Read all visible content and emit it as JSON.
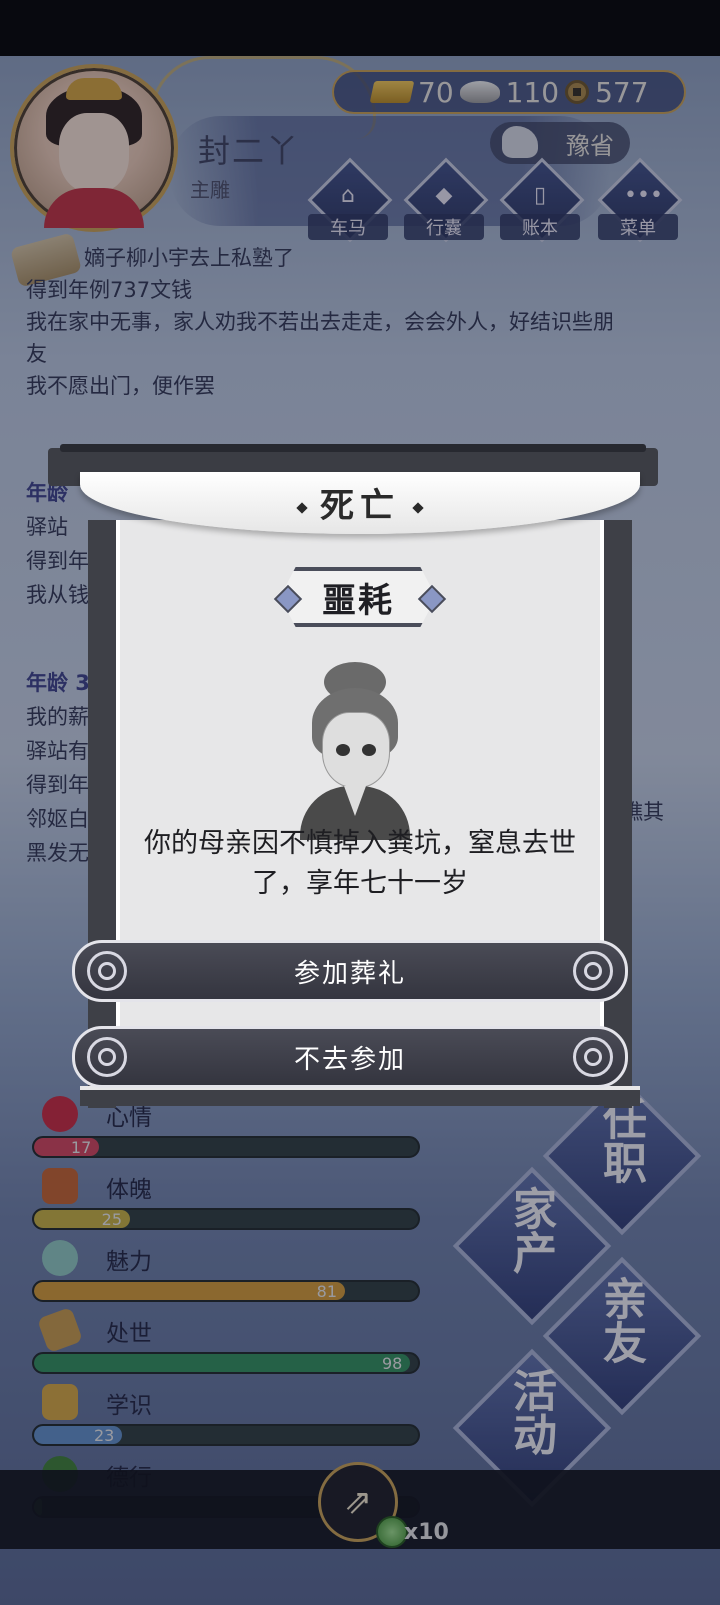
{
  "header": {
    "character_name": "封二丫",
    "character_rank": "主雕",
    "currency": {
      "gold": "70",
      "silver": "110",
      "copper": "577"
    },
    "region": "豫省"
  },
  "menu": [
    {
      "label": "车马",
      "icon": "carriage-icon"
    },
    {
      "label": "行囊",
      "icon": "bag-icon"
    },
    {
      "label": "账本",
      "icon": "ledger-icon"
    },
    {
      "label": "菜单",
      "icon": "more-icon"
    }
  ],
  "log": {
    "lines": [
      "嫡子柳小宇去上私塾了",
      "得到年例737文钱",
      "我在家中无事，家人劝我不若出去走走，会会外人，好结识些朋",
      "友",
      "我不愿出门，便作罢"
    ],
    "block2": {
      "head": "年龄",
      "lines": [
        "驿站",
        "得到年",
        "我从钱"
      ]
    },
    "block3": {
      "head": "年龄 3",
      "lines": [
        "我的薪",
        "驿站有",
        "得到年",
        "邻妪白",
        "黑发无"
      ],
      "tail": "瞧其"
    }
  },
  "stats": [
    {
      "name": "心情",
      "value": 17,
      "color": "#d2435b",
      "icon": "flower-icon"
    },
    {
      "name": "体魄",
      "value": 25,
      "color": "#c7b13f",
      "icon": "body-icon"
    },
    {
      "name": "魅力",
      "value": 81,
      "color": "#d39a34",
      "icon": "charm-icon"
    },
    {
      "name": "处世",
      "value": 98,
      "color": "#2f8f5b",
      "icon": "worldly-icon"
    },
    {
      "name": "学识",
      "value": 23,
      "color": "#5f8fc9",
      "icon": "book-icon"
    },
    {
      "name": "德行",
      "value": 0,
      "color": "#4a8f3f",
      "icon": "virtue-icon"
    }
  ],
  "side_actions": [
    "任职",
    "家产",
    "亲友",
    "活动"
  ],
  "bottom": {
    "multiplier": "x10"
  },
  "modal": {
    "title": "死亡",
    "subtitle": "噩耗",
    "message": "你的母亲因不慎掉入粪坑，窒息去世了，享年七十一岁",
    "buttons": {
      "attend": "参加葬礼",
      "decline": "不去参加"
    }
  }
}
